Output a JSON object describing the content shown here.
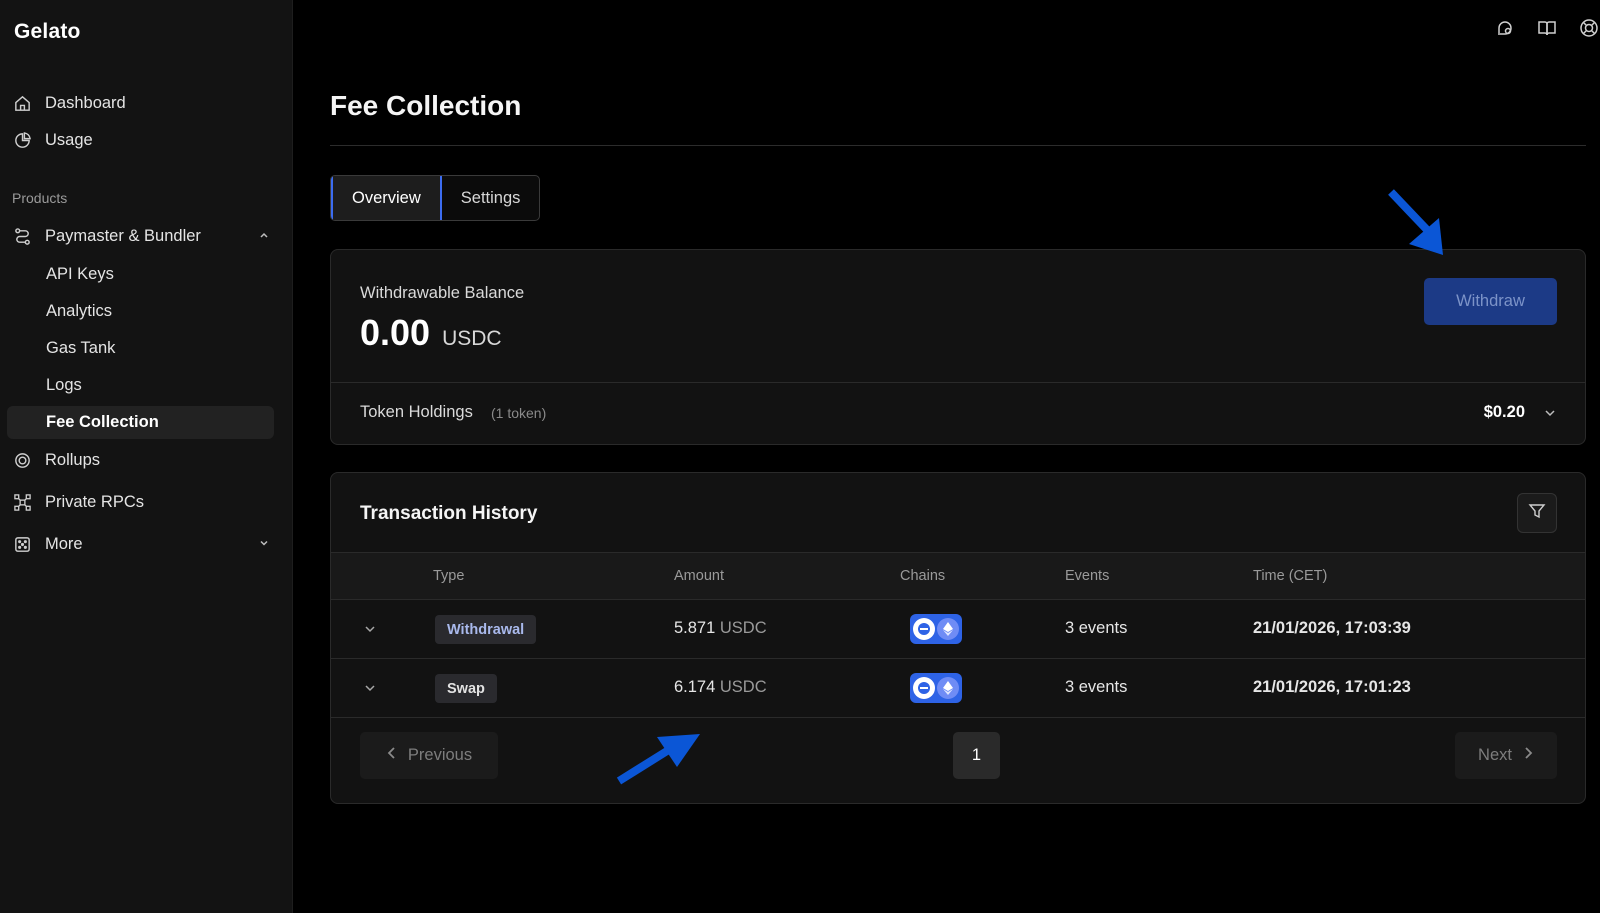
{
  "app": {
    "logo": "Gelato"
  },
  "sidebar": {
    "items": [
      {
        "label": "Dashboard",
        "icon": "home-icon"
      },
      {
        "label": "Usage",
        "icon": "pie-chart-icon"
      }
    ],
    "section_label": "Products",
    "paymaster": {
      "label": "Paymaster & Bundler",
      "icon": "route-icon",
      "expanded": true
    },
    "sub_items": [
      {
        "label": "API Keys"
      },
      {
        "label": "Analytics"
      },
      {
        "label": "Gas Tank"
      },
      {
        "label": "Logs"
      },
      {
        "label": "Fee Collection",
        "active": true
      }
    ],
    "more_items": [
      {
        "label": "Rollups",
        "icon": "rollups-icon"
      },
      {
        "label": "Private RPCs",
        "icon": "network-icon"
      },
      {
        "label": "More",
        "icon": "grid-dots-icon"
      }
    ]
  },
  "top_icons": [
    "chat-icon",
    "docs-book-icon",
    "support-lifebuoy-icon"
  ],
  "page": {
    "title": "Fee Collection",
    "tabs": [
      {
        "label": "Overview",
        "active": true
      },
      {
        "label": "Settings",
        "active": false
      }
    ]
  },
  "balance": {
    "label": "Withdrawable Balance",
    "amount": "0.00",
    "unit": "USDC",
    "withdraw_label": "Withdraw",
    "holdings_label": "Token Holdings",
    "holdings_count": "(1 token)",
    "holdings_value": "$0.20"
  },
  "transactions": {
    "title": "Transaction History",
    "columns": [
      "Type",
      "Amount",
      "Chains",
      "Events",
      "Time (CET)"
    ],
    "rows": [
      {
        "type": "Withdrawal",
        "amount": "5.871",
        "unit": "USDC",
        "events": "3 events",
        "time": "21/01/2026, 17:03:39"
      },
      {
        "type": "Swap",
        "amount": "6.174",
        "unit": "USDC",
        "events": "3 events",
        "time": "21/01/2026, 17:01:23"
      }
    ],
    "pagination": {
      "previous": "Previous",
      "page": "1",
      "next": "Next"
    }
  },
  "colors": {
    "accent": "#2e63e6",
    "arrow": "#0b56d6",
    "withdraw_bg": "#1c3a86"
  }
}
